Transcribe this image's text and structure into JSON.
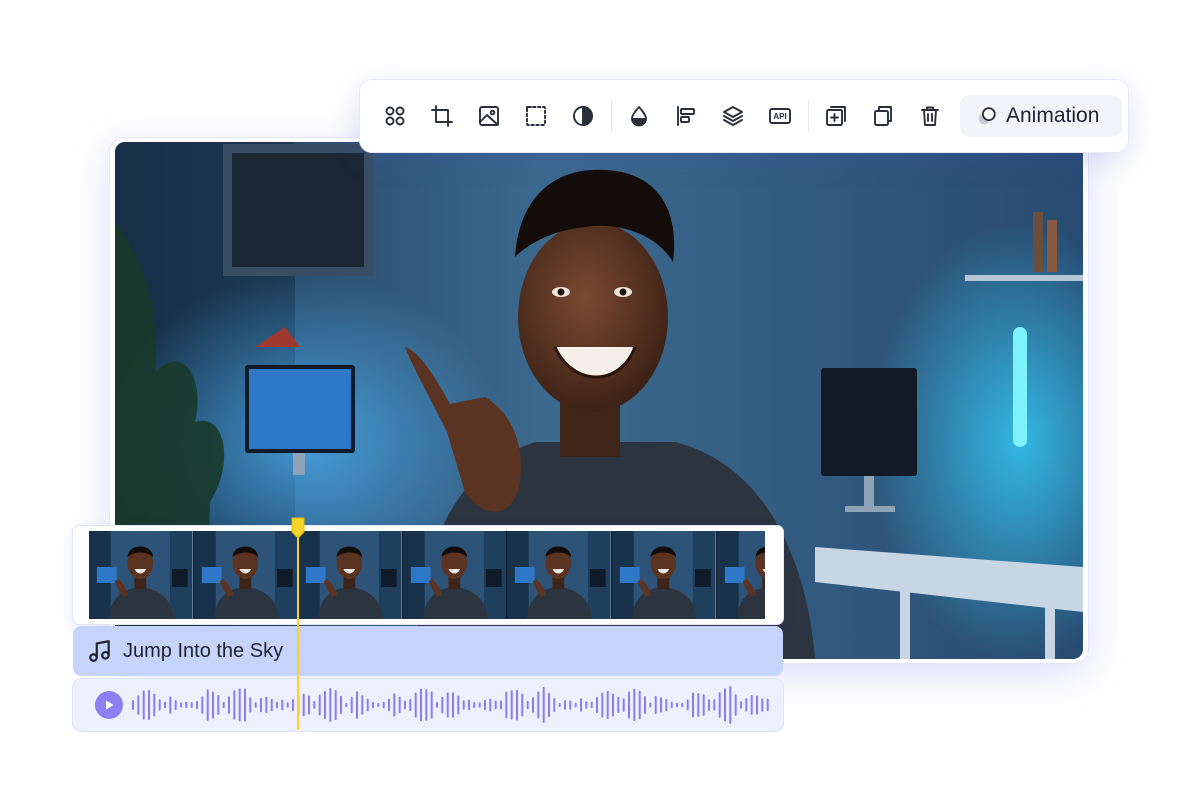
{
  "toolbar": {
    "tools": [
      {
        "icon": "shapes-icon"
      },
      {
        "icon": "crop-icon"
      },
      {
        "icon": "image-icon"
      },
      {
        "icon": "mask-icon"
      },
      {
        "icon": "contrast-icon"
      },
      {
        "icon": "color-drop-icon"
      },
      {
        "icon": "align-icon"
      },
      {
        "icon": "layers-icon"
      },
      {
        "icon": "api-icon",
        "label": "API"
      },
      {
        "icon": "add-frame-icon"
      },
      {
        "icon": "duplicate-icon"
      },
      {
        "icon": "delete-icon"
      }
    ],
    "animation_label": "Animation"
  },
  "timeline": {
    "music_track_title": "Jump Into the Sky",
    "filmstrip_frame_count": 7
  },
  "colors": {
    "accent_purple": "#8d7ff0",
    "music_track_bg": "#c6d3fb",
    "playhead": "#f7d32a",
    "waveform": "#8b7cf0"
  }
}
